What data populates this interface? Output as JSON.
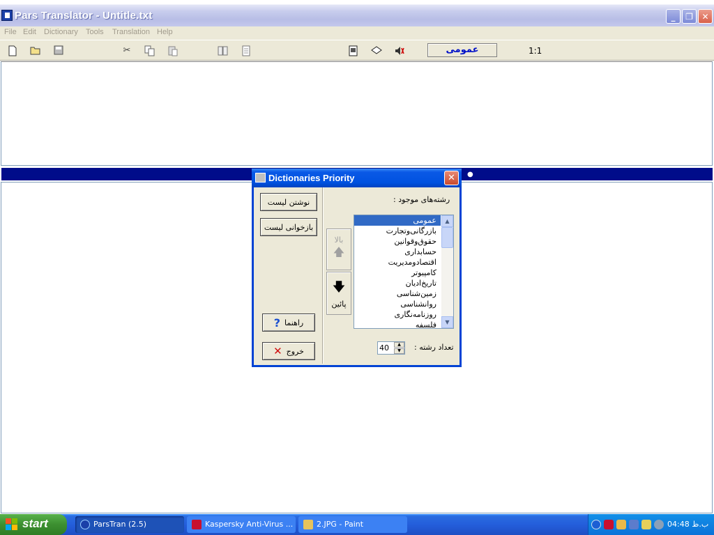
{
  "window": {
    "title": "Pars Translator - Untitle.txt",
    "minimize": "_",
    "maximize": "❐",
    "close": "✕"
  },
  "menu": [
    "File",
    "Edit",
    "Dictionary",
    "Tools",
    "Translation",
    "Help"
  ],
  "toolbar": {
    "active_dictionary": "عمومی",
    "ratio": "1:1"
  },
  "dialog": {
    "title": "Dictionaries Priority",
    "close": "✕",
    "write_list": "نوشتن لیست",
    "read_list": "بازخوانی لیست",
    "help": "راهنما",
    "exit": "خروج",
    "available_label": "رشته‌های موجود :",
    "up": "بالا",
    "down": "پائین",
    "count_label": "تعداد رشته :",
    "count_value": "40",
    "fields": [
      "عمومی",
      "بازرگانی‌وتجارت",
      "حقوق‌وقوانین",
      "حسابداری",
      "اقتصادومدیریت",
      "کامپیوتر",
      "تاریخ‌ادیان",
      "زمین‌شناسی",
      "روانشناسی",
      "روزنامه‌نگاری",
      "فلسفه"
    ],
    "selected_index": 0
  },
  "taskbar": {
    "start": "start",
    "tasks": [
      "ParsTran (2.5)",
      "Kaspersky Anti-Virus ...",
      "2.JPG - Paint"
    ],
    "clock": "04:48 ب.ظ"
  },
  "colors": {
    "splitter": "#000c8a",
    "selection": "#316ac5",
    "dictionary_text": "#0010c8"
  }
}
